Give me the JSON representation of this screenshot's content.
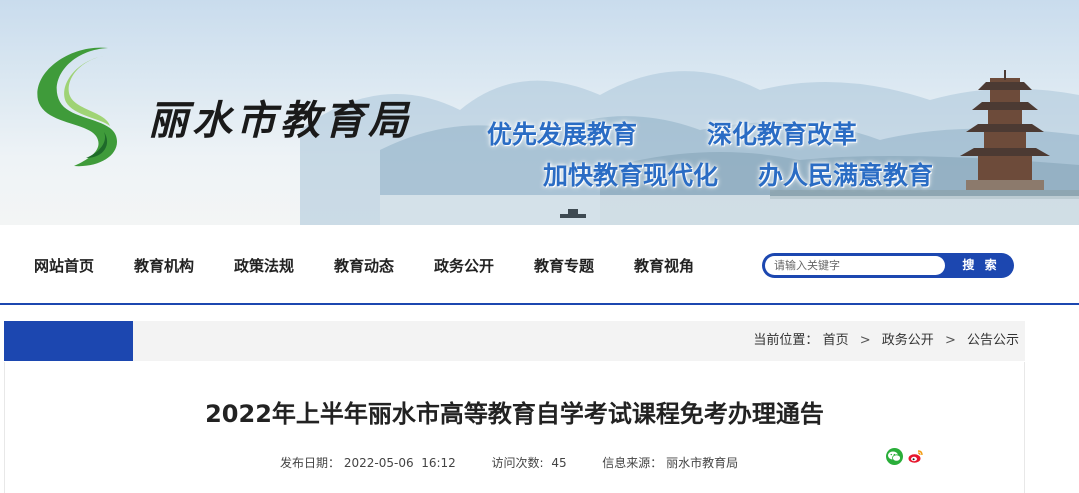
{
  "header": {
    "site_title": "丽水市教育局",
    "slogans": [
      "优先发展教育",
      "深化教育改革",
      "加快教育现代化",
      "办人民满意教育"
    ]
  },
  "nav": {
    "items": [
      {
        "label": "网站首页"
      },
      {
        "label": "教育机构"
      },
      {
        "label": "政策法规"
      },
      {
        "label": "教育动态"
      },
      {
        "label": "政务公开"
      },
      {
        "label": "教育专题"
      },
      {
        "label": "教育视角"
      }
    ],
    "search": {
      "placeholder": "请输入关键字",
      "button_label": "搜 索"
    }
  },
  "breadcrumb": {
    "prefix": "当前位置：",
    "items": [
      "首页",
      "政务公开",
      "公告公示"
    ],
    "separator": ">"
  },
  "article": {
    "title": "2022年上半年丽水市高等教育自学考试课程免考办理通告",
    "publish_label": "发布日期：",
    "publish_date": "2022-05-06  16:12",
    "visits_label": "访问次数:",
    "visits": "45",
    "source_label": "信息来源：",
    "source": "丽水市教育局"
  },
  "share": {
    "icons": [
      "wechat-icon",
      "weibo-icon"
    ]
  },
  "colors": {
    "accent": "#1c47b0",
    "slogan": "#2a6cc4",
    "logo_green": "#3f9b3a",
    "wechat": "#2aae3a",
    "weibo": "#e6162d"
  }
}
